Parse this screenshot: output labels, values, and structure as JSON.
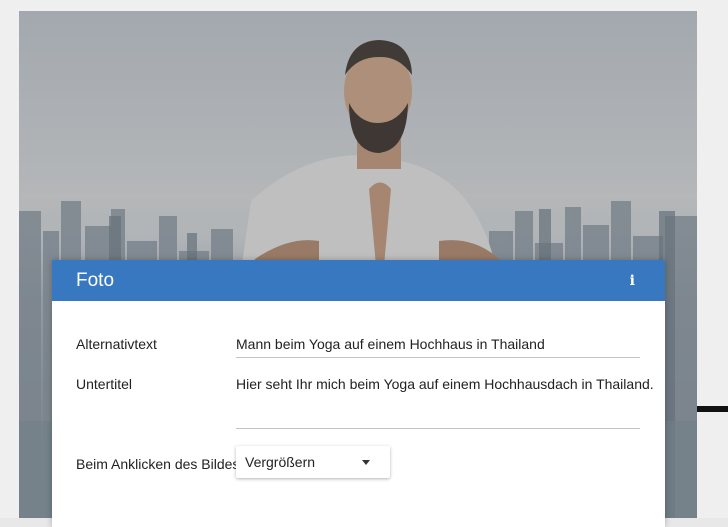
{
  "dialog": {
    "title": "Foto",
    "info_icon": "info-icon",
    "header_color": "#3778c0"
  },
  "fields": {
    "alt": {
      "label": "Alternativtext",
      "value": "Mann beim Yoga auf einem Hochhaus in Thailand"
    },
    "caption": {
      "label": "Untertitel",
      "value": "Hier seht Ihr mich beim Yoga auf einem Hochhausdach in Thailand."
    },
    "onclick": {
      "label": "Beim Anklicken des Bildes",
      "selected": "Vergrößern"
    }
  },
  "icons": {
    "info": "i",
    "dropdown": "chevron-down-icon"
  }
}
